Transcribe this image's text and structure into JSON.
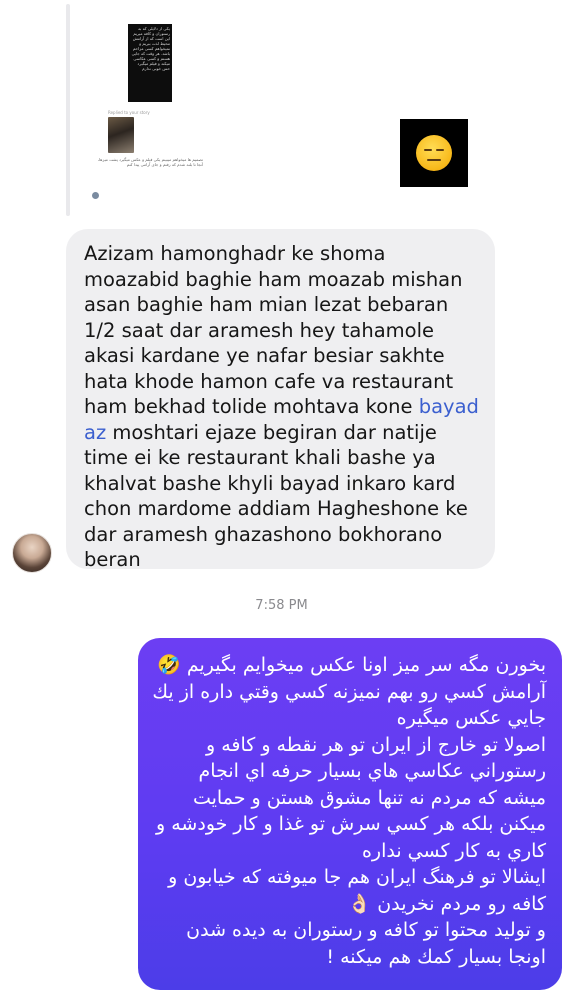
{
  "story_reply": {
    "story_text": "یکی از دلایلی که به رستوران و کافه میریم این است که از آرامش محیط لذت ببریم و نمیخواهم کسی مزاحم باشد. هر وقت که جایی هستم و کسی عکاسی میکند و فیلم میگیرد حس خوبی ندارم",
    "caption": "Replied to your story",
    "post_text": "تصمیم ها میخواهم میبینم یکی فیلم و عکس میگیرد پشت میزها، آنجا تا بلند شدم که رفتم و جای آرامی پیدا کنم"
  },
  "incoming_message": {
    "part1": "Azizam hamonghadr ke shoma moazabid baghie ham moazab mishan asan baghie ham mian lezat bebaran 1/2 saat dar aramesh hey tahamole akasi kardane ye nafar besiar sakhte hata khode hamon cafe va restaurant ham bekhad tolide mohtava kone ",
    "link": "bayad az",
    "part2": " moshtari ejaze begiran dar natije time ei ke restaurant khali bashe ya khalvat bashe khyli bayad inkaro kard chon mardome addiam Hagheshone ke dar aramesh ghazashono bokhorano beran"
  },
  "timestamp": "7:58 PM",
  "outgoing_message": {
    "line1": "بخورن مگه سر میز اونا عکس میخوایم بگیریم 🤣",
    "line2": "آرامش کسي رو بهم نميزنه کسي وقتي داره از يك جايي عكس ميگيره",
    "line3": "اصولا تو خارج از ايران تو هر نقطه و كافه و رستوراني عكاسي هاي بسيار حرفه اي انجام ميشه كه مردم نه تنها مشوق هستن و حمايت ميكنن بلكه هر كسي سرش تو غذا و كار خودشه و كاري به كار كسي نداره",
    "line4": "ايشالا تو فرهنگ ايران هم جا ميوفته كه خيابون و كافه رو مردم نخريدن 👌🏻",
    "line5": "و توليد محتوا تو كافه و رستوران به ديده شدن اونجا بسيار كمك هم ميكنه !"
  },
  "colors": {
    "incoming_bubble": "#efeff1",
    "outgoing_bubble": "#5e3cf2",
    "link": "#3b5fcf",
    "timestamp": "#8a8a8e"
  },
  "icons": {
    "reaction": "neutral-face-emoji"
  }
}
